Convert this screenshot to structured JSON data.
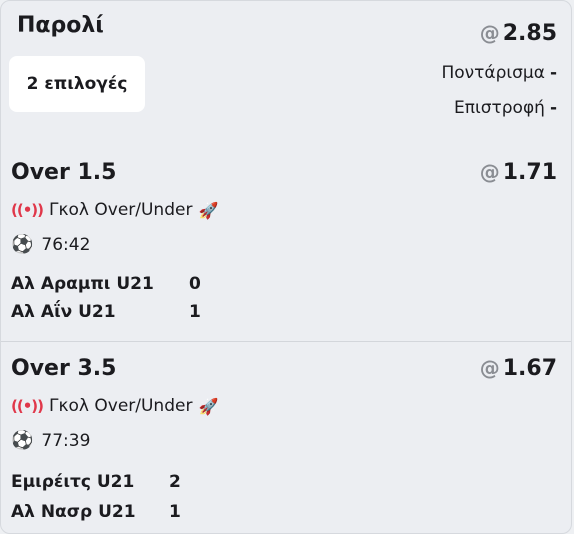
{
  "header": {
    "title": "Παρολί",
    "selections_label": "2 επιλογές",
    "total_odds": "2.85",
    "odds_prefix": "@",
    "stake_label": "Ποντάρισμα",
    "stake_value": "-",
    "return_label": "Επιστροφή",
    "return_value": "-"
  },
  "legs": [
    {
      "selection": "Over 1.5",
      "odds": "1.71",
      "market": "Γκολ Over/Under",
      "time": "76:42",
      "home_team": "Αλ Αραμπι U21",
      "home_score": "0",
      "away_team": "Αλ Αΐν U21",
      "away_score": "1"
    },
    {
      "selection": "Over 3.5",
      "odds": "1.67",
      "market": "Γκολ Over/Under",
      "time": "77:39",
      "home_team": "Εμιρέιτς U21",
      "home_score": "2",
      "away_team": "Αλ Νασρ U21",
      "away_score": "1"
    }
  ],
  "icons": {
    "live": "live-broadcast-icon",
    "boost": "rocket-boost-icon",
    "ball": "soccer-ball-icon"
  },
  "colors": {
    "live_accent": "#e0374a",
    "odds_prefix": "#8a8d93",
    "background": "#eceef2"
  }
}
